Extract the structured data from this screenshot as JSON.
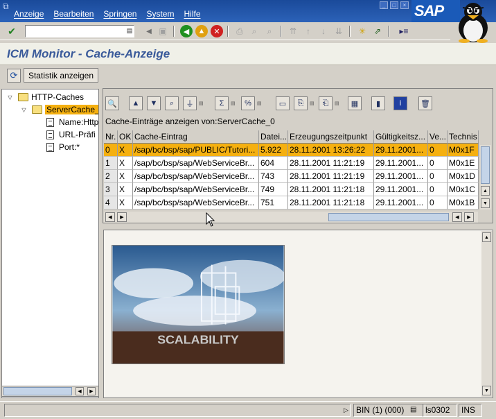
{
  "menu": {
    "items": [
      "Anzeige",
      "Bearbeiten",
      "Springen",
      "System",
      "Hilfe"
    ]
  },
  "brand": {
    "logo": "SAP"
  },
  "toolbar": {
    "command_value": ""
  },
  "title": "ICM Monitor - Cache-Anzeige",
  "app_toolbar": {
    "stats_button": "Statistik anzeigen"
  },
  "tree": {
    "root": "HTTP-Caches",
    "child": "ServerCache_",
    "leaves": [
      "Name:Http",
      "URL-Präfi",
      "Port:*"
    ]
  },
  "alv": {
    "caption": "Cache-Einträge anzeigen von:ServerCache_0",
    "columns": [
      "Nr.",
      "OK",
      "Cache-Eintrag",
      "Datei...",
      "Erzeugungszeitpunkt",
      "Gültigkeitsz...",
      "Ve...",
      "Technis"
    ],
    "rows": [
      [
        "0",
        "X",
        "/sap/bc/bsp/sap/PUBLIC/Tutori...",
        "5.922",
        "28.11.2001 13:26:22",
        "29.11.2001...",
        "0",
        "M0x1F"
      ],
      [
        "1",
        "X",
        "/sap/bc/bsp/sap/WebServiceBr...",
        "604",
        "28.11.2001 11:21:19",
        "29.11.2001...",
        "0",
        "M0x1E"
      ],
      [
        "2",
        "X",
        "/sap/bc/bsp/sap/WebServiceBr...",
        "743",
        "28.11.2001 11:21:19",
        "29.11.2001...",
        "0",
        "M0x1D"
      ],
      [
        "3",
        "X",
        "/sap/bc/bsp/sap/WebServiceBr...",
        "749",
        "28.11.2001 11:21:18",
        "29.11.2001...",
        "0",
        "M0x1C"
      ],
      [
        "4",
        "X",
        "/sap/bc/bsp/sap/WebServiceBr...",
        "751",
        "28.11.2001 11:21:18",
        "29.11.2001...",
        "0",
        "M0x1B"
      ]
    ],
    "selected_row": 0
  },
  "preview": {
    "image_text": "SCALABILITY"
  },
  "status": {
    "system": "BIN (1) (000)",
    "server": "ls0302",
    "mode": "INS"
  },
  "colors": {
    "menu_bar": "#2c62b8",
    "selection": "#f5b010",
    "title_text": "#3a5a9a"
  }
}
